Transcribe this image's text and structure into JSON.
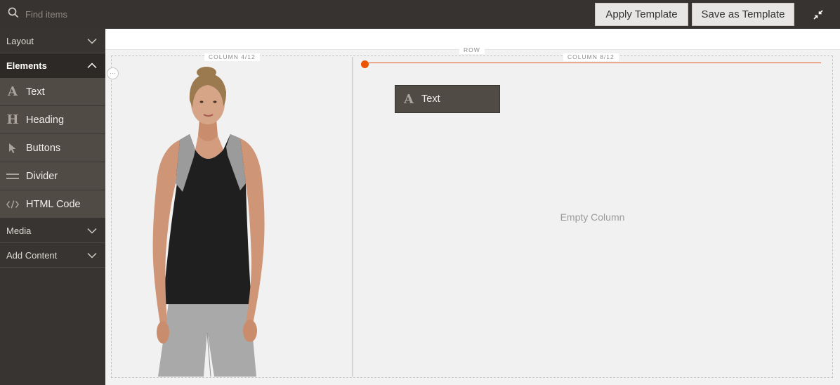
{
  "search": {
    "placeholder": "Find items",
    "value": ""
  },
  "toolbar": {
    "apply_label": "Apply Template",
    "save_label": "Save as Template",
    "collapse_icon": "collapse-arrows-icon"
  },
  "sidebar": {
    "sections": {
      "layout": "Layout",
      "elements": "Elements",
      "media": "Media",
      "add_content": "Add Content"
    },
    "items": [
      {
        "label": "Text",
        "icon": "text-icon"
      },
      {
        "label": "Heading",
        "icon": "heading-icon"
      },
      {
        "label": "Buttons",
        "icon": "cursor-icon"
      },
      {
        "label": "Divider",
        "icon": "divider-icon"
      },
      {
        "label": "HTML Code",
        "icon": "code-icon"
      }
    ]
  },
  "stage": {
    "row_label": "ROW",
    "column1_label": "COLUMN 4/12",
    "column2_label": "COLUMN 8/12",
    "drag_item_label": "Text",
    "empty_text": "Empty Column",
    "image_alt": "Woman wearing black and gray tank top with gray leggings"
  },
  "colors": {
    "topbar": "#373330",
    "sidebar": "#383431",
    "item": "#514b46",
    "accent": "#eb5202",
    "button": "#e8e6e4"
  }
}
